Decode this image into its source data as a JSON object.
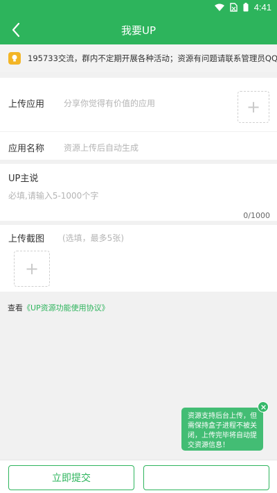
{
  "status_bar": {
    "time": "4:41"
  },
  "app_bar": {
    "title": "我要UP"
  },
  "notice": {
    "text": "195733交流，群内不定期开展各种活动；资源有问题请联系管理员QQ"
  },
  "upload_app": {
    "label": "上传应用",
    "placeholder": "分享你觉得有价值的应用"
  },
  "app_name": {
    "label": "应用名称",
    "placeholder": "资源上传后自动生成"
  },
  "up_says": {
    "label": "UP主说",
    "placeholder": "必填,请输入5-1000个字",
    "counter": "0/1000"
  },
  "screenshots": {
    "label": "上传截图",
    "hint": "(选填，最多5张)"
  },
  "agreement": {
    "prefix": "查看",
    "link": "《UP资源功能使用协议》"
  },
  "tooltip": {
    "text": "资源支持后台上传，但需保持盒子进程不被关闭，上传完毕将自动提交资源信息！"
  },
  "bottom_bar": {
    "submit_label": "立即提交"
  },
  "colors": {
    "brand_green": "#2db45c",
    "notice_icon": "#f3b526",
    "tooltip_bg": "#35b96a"
  }
}
